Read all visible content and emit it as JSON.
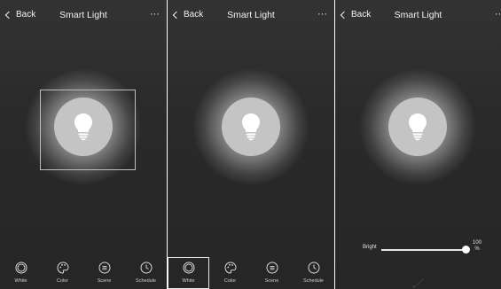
{
  "panels": [
    {
      "back": "Back",
      "title": "Smart Light",
      "more": "···",
      "tabs": [
        {
          "label": "White",
          "icon": "ring-icon"
        },
        {
          "label": "Color",
          "icon": "palette-icon"
        },
        {
          "label": "Scene",
          "icon": "scene-icon"
        },
        {
          "label": "Schedule",
          "icon": "clock-icon"
        }
      ],
      "selected_tab": null
    },
    {
      "back": "Back",
      "title": "Smart Light",
      "more": "···",
      "tabs": [
        {
          "label": "White",
          "icon": "ring-icon"
        },
        {
          "label": "Color",
          "icon": "palette-icon"
        },
        {
          "label": "Scene",
          "icon": "scene-icon"
        },
        {
          "label": "Schedule",
          "icon": "clock-icon"
        }
      ],
      "selected_tab": "White"
    },
    {
      "back": "Back",
      "title": "Smart Light",
      "more": "···",
      "bright": {
        "label": "Bright",
        "value": "100",
        "unit": "%",
        "level": 100
      }
    }
  ],
  "colors": {
    "background": "#2a2a2a",
    "bulb_circle": "#c4c4c4",
    "bulb": "#ffffff",
    "text": "#f2f2f2"
  }
}
